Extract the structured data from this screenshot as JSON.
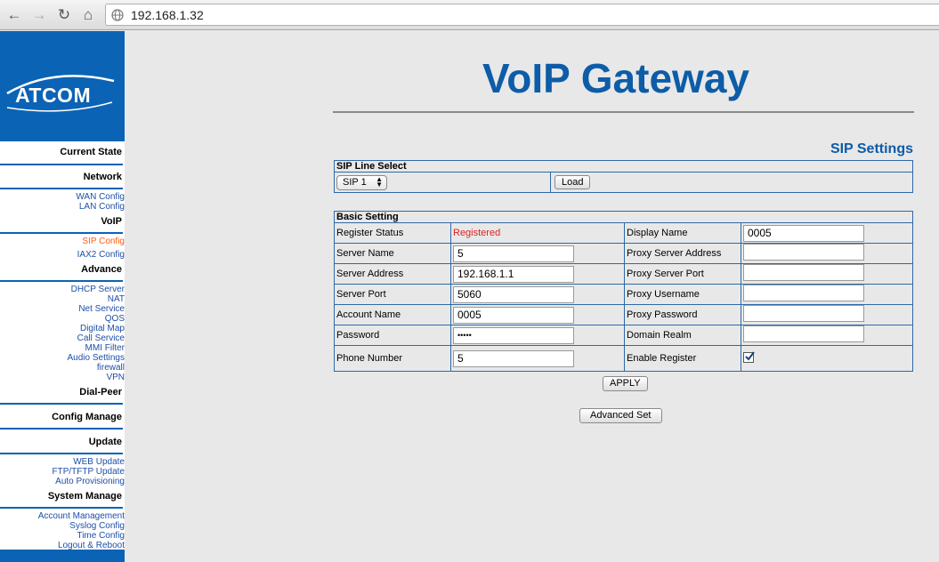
{
  "browser": {
    "url": "192.168.1.32",
    "back_icon": "back-arrow-icon",
    "forward_icon": "forward-arrow-icon",
    "reload_icon": "reload-icon",
    "home_icon": "home-icon"
  },
  "sidebar": {
    "logo": "ATCOM",
    "sections": {
      "current_state": "Current State",
      "network": "Network",
      "wan": "WAN Config",
      "lan": "LAN Config",
      "voip": "VoIP",
      "sip": "SIP Config",
      "iax2": "IAX2 Config",
      "advance": "Advance",
      "dhcp": "DHCP Server",
      "nat": "NAT",
      "net_service": "Net Service",
      "qos": "QOS",
      "digital_map": "Digital Map",
      "call_service": "Call Service",
      "mmi_filter": "MMI Filter",
      "audio_settings": "Audio Settings",
      "firewall": "firewall",
      "vpn": "VPN",
      "dial_peer": "Dial-Peer",
      "config_manage": "Config Manage",
      "update": "Update",
      "web_update": "WEB Update",
      "ftp_update": "FTP/TFTP Update",
      "auto_prov": "Auto Provisioning",
      "system_manage": "System Manage",
      "account_mgmt": "Account Management",
      "syslog": "Syslog Config",
      "time": "Time Config",
      "logout": "Logout & Reboot"
    }
  },
  "main": {
    "title": "VoIP Gateway",
    "subtitle": "SIP Settings",
    "line_select": {
      "header": "SIP Line Select",
      "selected": "SIP 1",
      "load_label": "Load"
    },
    "basic": {
      "header": "Basic Setting",
      "register_status_label": "Register Status",
      "register_status_value": "Registered",
      "server_name_label": "Server Name",
      "server_name_value": "5",
      "server_address_label": "Server Address",
      "server_address_value": "192.168.1.1",
      "server_port_label": "Server Port",
      "server_port_value": "5060",
      "account_name_label": "Account Name",
      "account_name_value": "0005",
      "password_label": "Password",
      "password_value": "•••••",
      "phone_number_label": "Phone Number",
      "phone_number_value": "5",
      "display_name_label": "Display Name",
      "display_name_value": "0005",
      "proxy_server_address_label": "Proxy Server Address",
      "proxy_server_address_value": "",
      "proxy_server_port_label": "Proxy Server Port",
      "proxy_server_port_value": "",
      "proxy_username_label": "Proxy Username",
      "proxy_username_value": "",
      "proxy_password_label": "Proxy Password",
      "proxy_password_value": "",
      "domain_realm_label": "Domain Realm",
      "domain_realm_value": "",
      "enable_register_label": "Enable Register",
      "enable_register_checked": true
    },
    "apply_label": "APPLY",
    "advanced_label": "Advanced Set"
  },
  "colors": {
    "brand_blue": "#0b63b5",
    "title_blue": "#0d5ca8",
    "link_blue": "#1d4fa8",
    "active_orange": "#ff5a14",
    "registered_red": "#e02020"
  }
}
